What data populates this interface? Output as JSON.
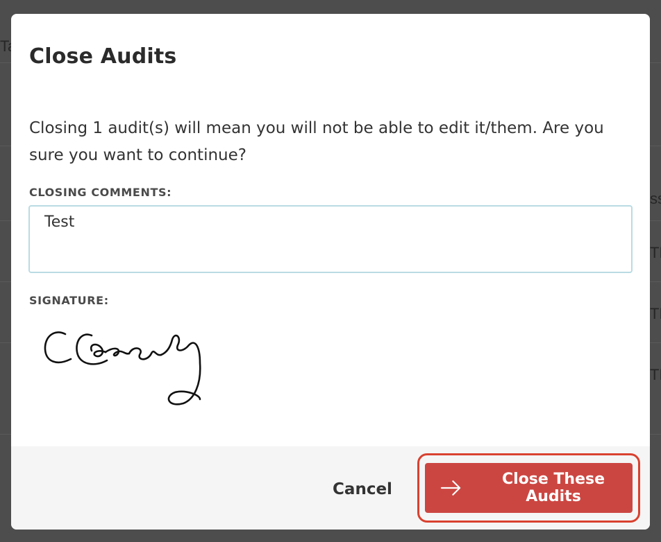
{
  "background": {
    "fragments": [
      "Ta",
      "ss",
      "TE",
      "TE",
      "TE"
    ]
  },
  "modal": {
    "title": "Close Audits",
    "message": "Closing 1 audit(s) will mean you will not be able to edit it/them. Are you sure you want to continue?",
    "comments_label": "CLOSING COMMENTS:",
    "comments_value": "Test",
    "signature_label": "SIGNATURE:",
    "signature_text": "CCasey"
  },
  "footer": {
    "cancel_label": "Cancel",
    "confirm_label": "Close These Audits",
    "confirm_icon": "arrow-right-icon"
  },
  "colors": {
    "accent": "#cc4641",
    "highlight": "#d9412f",
    "input_border": "#b9dbe3"
  }
}
